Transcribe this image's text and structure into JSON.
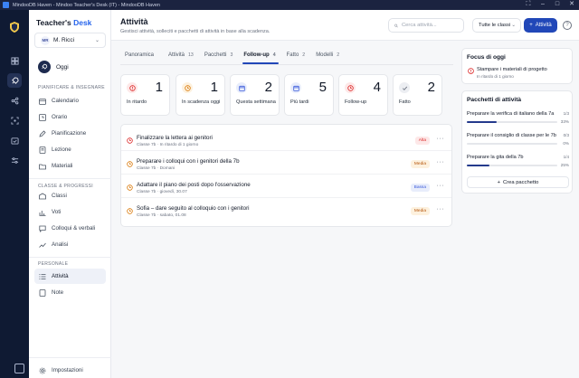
{
  "window": {
    "title": "MindooDB Haven - Mindoo Teacher's Desk (IT) - MindooDB Haven"
  },
  "brand": {
    "part1": "Teacher's ",
    "part2": "Desk"
  },
  "user": {
    "initials": "MR",
    "name": "M. Ricci"
  },
  "home": {
    "label": "Oggi"
  },
  "sidebar": {
    "sections": [
      {
        "title": "PIANIFICARE & INSEGNARE",
        "items": [
          {
            "label": "Calendario",
            "icon": "calendar-icon"
          },
          {
            "label": "Orario",
            "icon": "clock-icon"
          },
          {
            "label": "Pianificazione",
            "icon": "pencil-icon"
          },
          {
            "label": "Lezione",
            "icon": "book-icon"
          },
          {
            "label": "Materiali",
            "icon": "folder-icon"
          }
        ]
      },
      {
        "title": "CLASSE & PROGRESSI",
        "items": [
          {
            "label": "Classi",
            "icon": "school-icon"
          },
          {
            "label": "Voti",
            "icon": "chart-icon"
          },
          {
            "label": "Colloqui & verbali",
            "icon": "chat-icon"
          },
          {
            "label": "Analisi",
            "icon": "trend-icon"
          }
        ]
      },
      {
        "title": "PERSONALE",
        "items": [
          {
            "label": "Attività",
            "icon": "list-icon",
            "active": true
          },
          {
            "label": "Note",
            "icon": "note-icon"
          }
        ]
      }
    ],
    "settings_label": "Impostazioni"
  },
  "header": {
    "title": "Attività",
    "subtitle": "Gestisci attività, solleciti e pacchetti di attività in base alla scadenza.",
    "search_placeholder": "Cerca attività...",
    "class_filter": "Tutte le classi",
    "add_label": "Attività",
    "help_label": "?"
  },
  "tabs": [
    {
      "label": "Panoramica",
      "count": ""
    },
    {
      "label": "Attività",
      "count": "13"
    },
    {
      "label": "Pacchetti",
      "count": "3"
    },
    {
      "label": "Follow-up",
      "count": "4",
      "active": true
    },
    {
      "label": "Fatto",
      "count": "2"
    },
    {
      "label": "Modelli",
      "count": "2"
    }
  ],
  "stats": [
    {
      "label": "In ritardo",
      "value": "1",
      "color": "#dc2626",
      "bg": "#fde8e8",
      "icon": "alert-icon"
    },
    {
      "label": "In scadenza oggi",
      "value": "1",
      "color": "#d97706",
      "bg": "#fdf1de",
      "icon": "clock-icon"
    },
    {
      "label": "Questa settimana",
      "value": "2",
      "color": "#3b5bdb",
      "bg": "#e8edfb",
      "icon": "calendar-icon"
    },
    {
      "label": "Più tardi",
      "value": "5",
      "color": "#3b5bdb",
      "bg": "#e8edfb",
      "icon": "calendar-icon"
    },
    {
      "label": "Follow-up",
      "value": "4",
      "color": "#dc2626",
      "bg": "#fde8e8",
      "icon": "clock-icon"
    },
    {
      "label": "Fatto",
      "value": "2",
      "color": "#6b7280",
      "bg": "#eceef2",
      "icon": "check-icon"
    }
  ],
  "tasks": [
    {
      "title": "Finalizzare la lettera ai genitori",
      "meta": "Classe 7b · In ritardo di 1 giorno",
      "badge": "Alta",
      "badge_color": "#dc2626",
      "badge_bg": "#fde8e8",
      "icon_color": "#dc2626"
    },
    {
      "title": "Preparare i colloqui con i genitori della 7b",
      "meta": "Classe 7b · Domani",
      "badge": "Media",
      "badge_color": "#b45309",
      "badge_bg": "#fdf1de",
      "icon_color": "#d97706"
    },
    {
      "title": "Adattare il piano dei posti dopo l'osservazione",
      "meta": "Classe 7b · giovedì, 30.07",
      "badge": "Bassa",
      "badge_color": "#3b5bdb",
      "badge_bg": "#e8edfb",
      "icon_color": "#d97706"
    },
    {
      "title": "Sofia – dare seguito al colloquio con i genitori",
      "meta": "Classe 7b · sabato, 01.08",
      "badge": "Media",
      "badge_color": "#b45309",
      "badge_bg": "#fdf1de",
      "icon_color": "#d97706"
    }
  ],
  "focus": {
    "title": "Focus di oggi",
    "item": {
      "title": "Stampare i materiali di progetto",
      "meta": "In ritardo di 1 giorno"
    }
  },
  "packages": {
    "title": "Pacchetti di attività",
    "items": [
      {
        "name": "Preparare la verifica di italiano della 7a",
        "count": "1/3",
        "pct": "33%",
        "fill": 0.33
      },
      {
        "name": "Preparare il consiglio di classe per le 7b",
        "count": "0/3",
        "pct": "0%",
        "fill": 0.0
      },
      {
        "name": "Preparare la gita della 7b",
        "count": "1/4",
        "pct": "25%",
        "fill": 0.25
      }
    ],
    "create_label": "Crea pacchetto"
  },
  "colors": {
    "primary": "#2147b8",
    "rail": "#0f1a33",
    "titlebar": "#1b2340"
  }
}
